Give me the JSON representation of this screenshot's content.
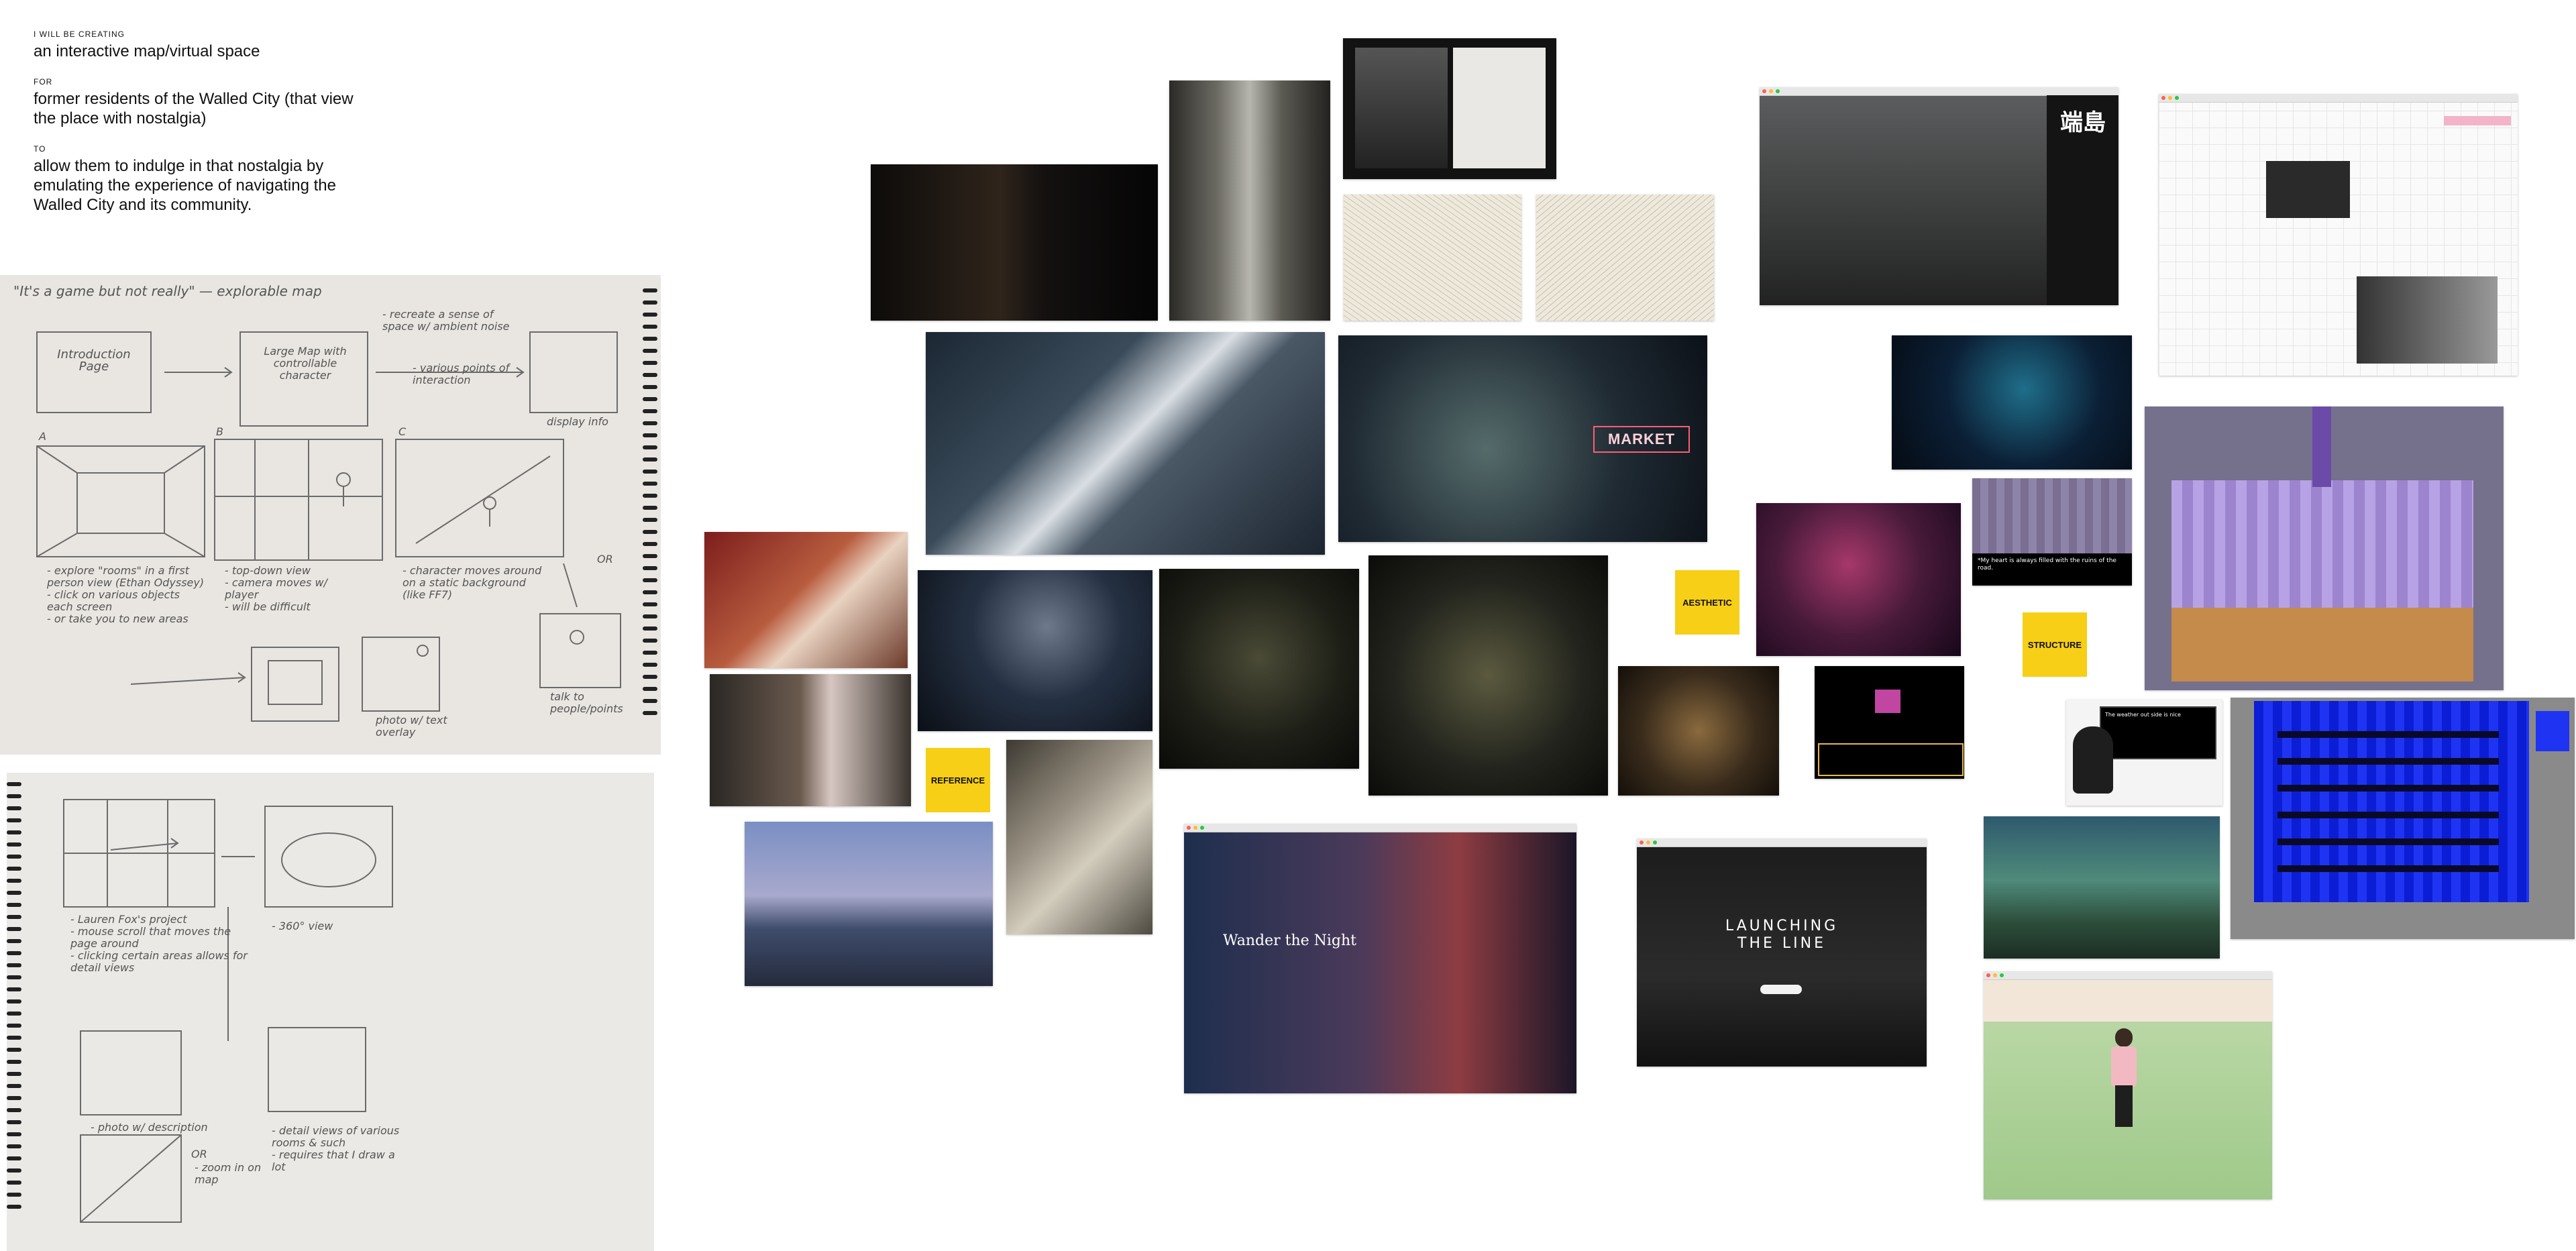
{
  "brief": {
    "creating_label": "I WILL BE CREATING",
    "creating_text": "an interactive map/virtual space",
    "for_label": "FOR",
    "for_text": "former residents of the Walled City (that view the place with nostalgia)",
    "to_label": "TO",
    "to_text": "allow them to indulge in that nostalgia by emulating the experience of navigating the Walled City and its community."
  },
  "sketch1": {
    "title": "\"It's a game but not really\" — explorable map",
    "intro_box": "Introduction Page",
    "map_box": "Large Map with controllable character",
    "note_space": "- recreate a sense of space w/ ambient noise",
    "note_points": "- various points of interaction",
    "note_display": "display info",
    "label_a": "A",
    "label_b": "B",
    "label_c": "C",
    "note_a": "- explore \"rooms\" in a first person view (Ethan Odyssey)\n- click on various objects each screen\n- or take you to new areas",
    "note_b": "- top-down view\n- camera moves w/ player\n- will be difficult",
    "note_c": "- character moves around on a static background (like FF7)",
    "note_or": "OR",
    "note_photo": "photo w/ text overlay",
    "note_talk": "talk to people/points"
  },
  "sketch2": {
    "note_lauren": "- Lauren Fox's project\n- mouse scroll that moves the page around\n- clicking certain areas allows for detail views",
    "note_360": "- 360° view",
    "note_photo_desc": "- photo w/ description",
    "note_or": "OR",
    "note_zoom": "- zoom in on map",
    "note_detail": "- detail views of various rooms & such\n- requires that I draw a lot"
  },
  "stickies": {
    "aesthetic": "AESTHETIC",
    "reference": "REFERENCE",
    "structure": "STRUCTURE"
  },
  "tiles": {
    "market_sign": "MARKET",
    "wander_title": "Wander the Night",
    "launch_title": "LAUNCHING THE LINE",
    "gunkanjima_title": "端島",
    "game_dialog": "*My heart is always filled with the ruins of the road.",
    "deltarune_text": "The weather out side is nice"
  },
  "colors": {
    "sticky": "#f6cf16",
    "sketch_paper": "#e9e6e1"
  }
}
